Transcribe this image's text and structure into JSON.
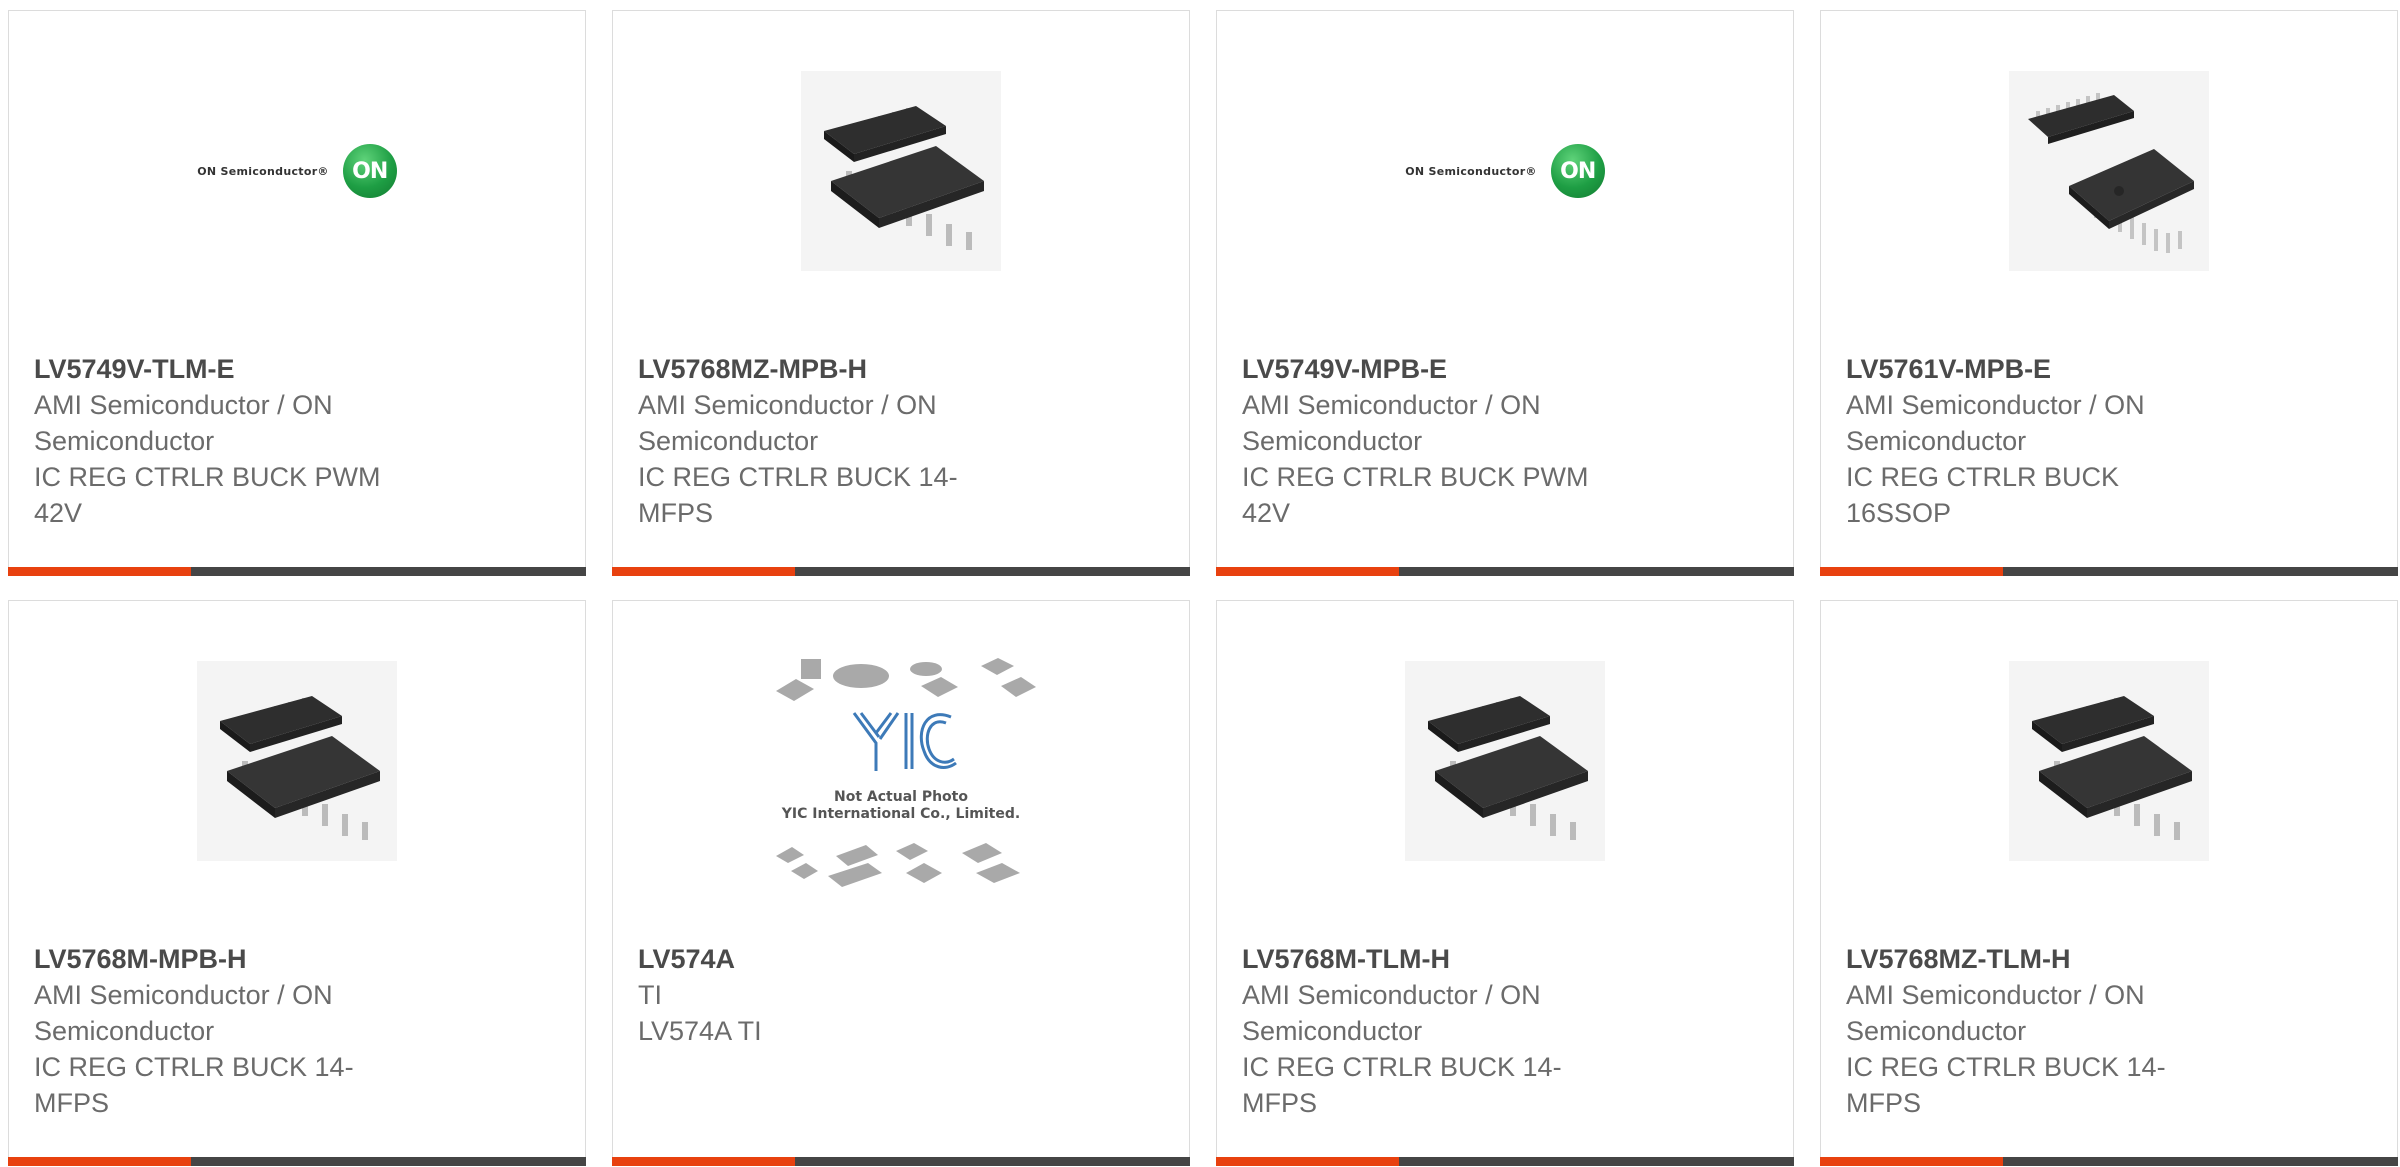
{
  "products": [
    {
      "part_number": "LV5749V-TLM-E",
      "manufacturer": "AMI Semiconductor / ON Semiconductor",
      "description": "IC REG CTRLR BUCK PWM 42V",
      "image": "on-semiconductor-logo",
      "logo_text": "ON Semiconductor®",
      "logo_mark": "ON"
    },
    {
      "part_number": "LV5768MZ-MPB-H",
      "manufacturer": "AMI Semiconductor / ON Semiconductor",
      "description": "IC REG CTRLR BUCK 14-MFPS",
      "image": "soic-chip-photo"
    },
    {
      "part_number": "LV5749V-MPB-E",
      "manufacturer": "AMI Semiconductor / ON Semiconductor",
      "description": "IC REG CTRLR BUCK PWM 42V",
      "image": "on-semiconductor-logo",
      "logo_text": "ON Semiconductor®",
      "logo_mark": "ON"
    },
    {
      "part_number": "LV5761V-MPB-E",
      "manufacturer": "AMI Semiconductor / ON Semiconductor",
      "description": "IC REG CTRLR BUCK 16SSOP",
      "image": "ssop-chip-photo"
    },
    {
      "part_number": "LV5768M-MPB-H",
      "manufacturer": "AMI Semiconductor / ON Semiconductor",
      "description": "IC REG CTRLR BUCK 14-MFPS",
      "image": "soic-chip-photo"
    },
    {
      "part_number": "LV574A",
      "manufacturer": "TI",
      "description": "LV574A TI",
      "image": "yic-placeholder",
      "placeholder_line1": "Not Actual Photo",
      "placeholder_line2": "YIC International Co., Limited."
    },
    {
      "part_number": "LV5768M-TLM-H",
      "manufacturer": "AMI Semiconductor / ON Semiconductor",
      "description": "IC REG CTRLR BUCK 14-MFPS",
      "image": "soic-chip-photo"
    },
    {
      "part_number": "LV5768MZ-TLM-H",
      "manufacturer": "AMI Semiconductor / ON Semiconductor",
      "description": "IC REG CTRLR BUCK 14-MFPS",
      "image": "soic-chip-photo"
    }
  ],
  "colors": {
    "accent": "#e8410f",
    "bar": "#454545",
    "border": "#dcdcdc",
    "part_text": "#4a4a4a",
    "meta_text": "#6b6b6b",
    "on_green": "#1e9e44"
  }
}
